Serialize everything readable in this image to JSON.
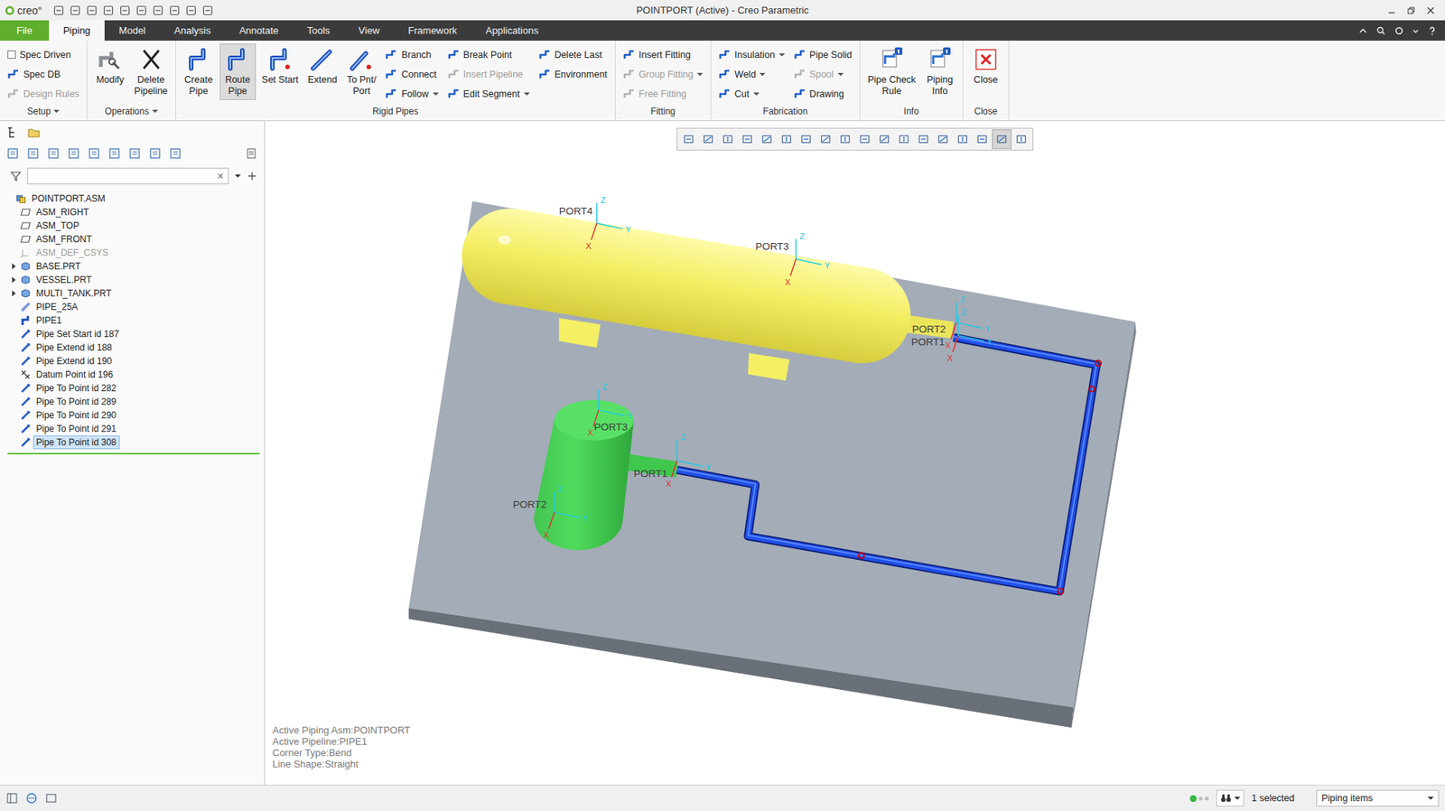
{
  "window": {
    "logo": "creo°",
    "title": "POINTPORT (Active) - Creo Parametric"
  },
  "menu_tabs": [
    {
      "label": "File",
      "kind": "file",
      "selected": false
    },
    {
      "label": "Piping",
      "kind": "tab",
      "selected": true
    },
    {
      "label": "Model",
      "kind": "tab",
      "selected": false
    },
    {
      "label": "Analysis",
      "kind": "tab",
      "selected": false
    },
    {
      "label": "Annotate",
      "kind": "tab",
      "selected": false
    },
    {
      "label": "Tools",
      "kind": "tab",
      "selected": false
    },
    {
      "label": "View",
      "kind": "tab",
      "selected": false
    },
    {
      "label": "Framework",
      "kind": "tab",
      "selected": false
    },
    {
      "label": "Applications",
      "kind": "tab",
      "selected": false
    }
  ],
  "ribbon": {
    "groups": [
      {
        "label": "Setup",
        "dropdown": true,
        "columns": [
          {
            "kind": "stack",
            "items": [
              {
                "label": "Spec Driven",
                "kind": "checkbox",
                "checked": false,
                "disabled": false,
                "dropdown": false
              },
              {
                "label": "Spec DB",
                "kind": "button",
                "checked": false,
                "disabled": false,
                "dropdown": false
              },
              {
                "label": "Design Rules",
                "kind": "button",
                "checked": false,
                "disabled": true,
                "dropdown": false
              }
            ]
          }
        ]
      },
      {
        "label": "Operations",
        "dropdown": true,
        "columns": [
          {
            "kind": "large",
            "lines": [
              "Modify"
            ],
            "selected": false,
            "disabled": false
          },
          {
            "kind": "large",
            "lines": [
              "Delete",
              "Pipeline"
            ],
            "selected": false,
            "disabled": false
          }
        ]
      },
      {
        "label": "Rigid Pipes",
        "dropdown": false,
        "columns": [
          {
            "kind": "large",
            "lines": [
              "Create",
              "Pipe"
            ],
            "selected": false,
            "disabled": false
          },
          {
            "kind": "large",
            "lines": [
              "Route",
              "Pipe"
            ],
            "selected": true,
            "disabled": false
          },
          {
            "kind": "large",
            "lines": [
              "Set Start"
            ],
            "selected": false,
            "disabled": false
          },
          {
            "kind": "large",
            "lines": [
              "Extend"
            ],
            "selected": false,
            "disabled": false
          },
          {
            "kind": "large",
            "lines": [
              "To Pnt/",
              "Port"
            ],
            "selected": false,
            "disabled": false
          },
          {
            "kind": "stack",
            "items": [
              {
                "label": "Branch",
                "kind": "button",
                "checked": false,
                "disabled": false,
                "dropdown": false
              },
              {
                "label": "Connect",
                "kind": "button",
                "checked": false,
                "disabled": false,
                "dropdown": false
              },
              {
                "label": "Follow",
                "kind": "button",
                "checked": false,
                "disabled": false,
                "dropdown": true
              }
            ]
          },
          {
            "kind": "stack",
            "items": [
              {
                "label": "Break Point",
                "kind": "button",
                "checked": false,
                "disabled": false,
                "dropdown": false
              },
              {
                "label": "Insert Pipeline",
                "kind": "button",
                "checked": false,
                "disabled": true,
                "dropdown": false
              },
              {
                "label": "Edit Segment",
                "kind": "button",
                "checked": false,
                "disabled": false,
                "dropdown": true
              }
            ]
          },
          {
            "kind": "stack",
            "items": [
              {
                "label": "Delete Last",
                "kind": "button",
                "checked": false,
                "disabled": false,
                "dropdown": false
              },
              {
                "label": "Environment",
                "kind": "button",
                "checked": false,
                "disabled": false,
                "dropdown": false
              }
            ]
          }
        ]
      },
      {
        "label": "Fitting",
        "dropdown": false,
        "columns": [
          {
            "kind": "stack",
            "items": [
              {
                "label": "Insert Fitting",
                "kind": "button",
                "checked": false,
                "disabled": false,
                "dropdown": false
              },
              {
                "label": "Group Fitting",
                "kind": "button",
                "checked": false,
                "disabled": true,
                "dropdown": true
              },
              {
                "label": "Free Fitting",
                "kind": "button",
                "checked": false,
                "disabled": true,
                "dropdown": false
              }
            ]
          }
        ]
      },
      {
        "label": "Fabrication",
        "dropdown": false,
        "columns": [
          {
            "kind": "stack",
            "items": [
              {
                "label": "Insulation",
                "kind": "button",
                "checked": false,
                "disabled": false,
                "dropdown": true
              },
              {
                "label": "Weld",
                "kind": "button",
                "checked": false,
                "disabled": false,
                "dropdown": true
              },
              {
                "label": "Cut",
                "kind": "button",
                "checked": false,
                "disabled": false,
                "dropdown": true
              }
            ]
          },
          {
            "kind": "stack",
            "items": [
              {
                "label": "Pipe Solid",
                "kind": "button",
                "checked": false,
                "disabled": false,
                "dropdown": false
              },
              {
                "label": "Spool",
                "kind": "button",
                "checked": false,
                "disabled": true,
                "dropdown": true
              },
              {
                "label": "Drawing",
                "kind": "button",
                "checked": false,
                "disabled": false,
                "dropdown": false
              }
            ]
          }
        ]
      },
      {
        "label": "Info",
        "dropdown": false,
        "columns": [
          {
            "kind": "large",
            "lines": [
              "Pipe Check",
              "Rule"
            ],
            "selected": false,
            "disabled": false
          },
          {
            "kind": "large",
            "lines": [
              "Piping",
              "Info"
            ],
            "selected": false,
            "disabled": false
          }
        ]
      },
      {
        "label": "Close",
        "dropdown": false,
        "columns": [
          {
            "kind": "large",
            "lines": [
              "Close"
            ],
            "selected": false,
            "disabled": false
          }
        ]
      }
    ]
  },
  "tree": {
    "filter": {
      "value": ""
    },
    "items": [
      {
        "label": "POINTPORT.ASM",
        "kind": "asm",
        "expandable": false,
        "expanded": false,
        "selected": false,
        "disabled": false
      },
      {
        "label": "ASM_RIGHT",
        "kind": "plane",
        "expandable": false,
        "expanded": false,
        "selected": false,
        "disabled": false
      },
      {
        "label": "ASM_TOP",
        "kind": "plane",
        "expandable": false,
        "expanded": false,
        "selected": false,
        "disabled": false
      },
      {
        "label": "ASM_FRONT",
        "kind": "plane",
        "expandable": false,
        "expanded": false,
        "selected": false,
        "disabled": false
      },
      {
        "label": "ASM_DEF_CSYS",
        "kind": "csys",
        "expandable": false,
        "expanded": false,
        "selected": false,
        "disabled": true
      },
      {
        "label": "BASE.PRT",
        "kind": "part",
        "expandable": true,
        "expanded": false,
        "selected": false,
        "disabled": false
      },
      {
        "label": "VESSEL.PRT",
        "kind": "part",
        "expandable": true,
        "expanded": false,
        "selected": false,
        "disabled": false
      },
      {
        "label": "MULTI_TANK.PRT",
        "kind": "part",
        "expandable": true,
        "expanded": false,
        "selected": false,
        "disabled": false
      },
      {
        "label": "PIPE_25A",
        "kind": "pipe-part",
        "expandable": false,
        "expanded": false,
        "selected": false,
        "disabled": false
      },
      {
        "label": "PIPE1",
        "kind": "pipeline",
        "expandable": false,
        "expanded": false,
        "selected": false,
        "disabled": false
      },
      {
        "label": "Pipe Set Start id 187",
        "kind": "feature",
        "expandable": false,
        "expanded": false,
        "selected": false,
        "disabled": false
      },
      {
        "label": "Pipe Extend id 188",
        "kind": "feature",
        "expandable": false,
        "expanded": false,
        "selected": false,
        "disabled": false
      },
      {
        "label": "Pipe Extend id 190",
        "kind": "feature",
        "expandable": false,
        "expanded": false,
        "selected": false,
        "disabled": false
      },
      {
        "label": "Datum Point id 196",
        "kind": "datum",
        "expandable": false,
        "expanded": false,
        "selected": false,
        "disabled": false
      },
      {
        "label": "Pipe To Point id 282",
        "kind": "feature",
        "expandable": false,
        "expanded": false,
        "selected": false,
        "disabled": false
      },
      {
        "label": "Pipe To Point id 289",
        "kind": "feature",
        "expandable": false,
        "expanded": false,
        "selected": false,
        "disabled": false
      },
      {
        "label": "Pipe To Point id 290",
        "kind": "feature",
        "expandable": false,
        "expanded": false,
        "selected": false,
        "disabled": false
      },
      {
        "label": "Pipe To Point id 291",
        "kind": "feature",
        "expandable": false,
        "expanded": false,
        "selected": false,
        "disabled": false
      },
      {
        "label": "Pipe To Point id 308",
        "kind": "feature",
        "expandable": false,
        "expanded": false,
        "selected": true,
        "disabled": false
      }
    ]
  },
  "view_toolbar": {
    "buttons": [
      {
        "selected": false
      },
      {
        "selected": false
      },
      {
        "selected": false
      },
      {
        "selected": false
      },
      {
        "selected": false
      },
      {
        "selected": false
      },
      {
        "selected": false
      },
      {
        "selected": false
      },
      {
        "selected": false
      },
      {
        "selected": false
      },
      {
        "selected": false
      },
      {
        "selected": false
      },
      {
        "selected": false
      },
      {
        "selected": false
      },
      {
        "selected": false
      },
      {
        "selected": false
      },
      {
        "selected": true
      },
      {
        "selected": false
      }
    ]
  },
  "model": {
    "vessel_ports": [
      "PORT4",
      "PORT3",
      "PORT2",
      "PORT1"
    ],
    "tank_ports": [
      "PORT3",
      "PORT1",
      "PORT2"
    ],
    "axis_labels": [
      "X",
      "Y",
      "Z"
    ]
  },
  "canvas_info": [
    "Active Piping Asm:POINTPORT",
    "Active Pipeline:PIPE1",
    "Corner Type:Bend",
    "Line Shape:Straight"
  ],
  "status_bar": {
    "selection": "1 selected",
    "filter": "Piping items"
  }
}
